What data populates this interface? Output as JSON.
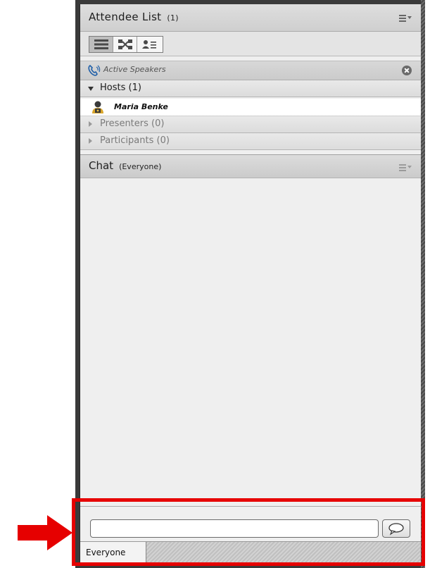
{
  "attendee_pod": {
    "title": "Attendee List",
    "count": "(1)",
    "menu_icon": "menu-icon"
  },
  "view_toolbar": {
    "buttons": [
      {
        "name": "list-view",
        "icon": "list-view-icon",
        "active": true
      },
      {
        "name": "breakout-view",
        "icon": "breakout-icon",
        "active": false
      },
      {
        "name": "status-view",
        "icon": "person-list-icon",
        "active": false
      }
    ]
  },
  "active_speakers": {
    "label": "Active Speakers",
    "icon": "phone-speaker-icon",
    "close_icon": "close-circle-icon"
  },
  "groups": {
    "hosts": {
      "label": "Hosts (1)",
      "expanded": true
    },
    "presenters": {
      "label": "Presenters (0)",
      "expanded": false
    },
    "participants": {
      "label": "Participants (0)",
      "expanded": false
    }
  },
  "attendees": [
    {
      "name": "Maria Benke",
      "icon": "host-user-icon"
    }
  ],
  "chat_pod": {
    "title": "Chat",
    "scope": "(Everyone)",
    "menu_icon": "menu-icon"
  },
  "chat_input": {
    "value": "",
    "placeholder": ""
  },
  "send_button": {
    "icon": "speech-bubble-icon"
  },
  "chat_tabs": [
    {
      "label": "Everyone",
      "active": true
    }
  ],
  "colors": {
    "highlight": "#e60000",
    "frame": "#3a3a3a",
    "panel": "#efefef"
  }
}
